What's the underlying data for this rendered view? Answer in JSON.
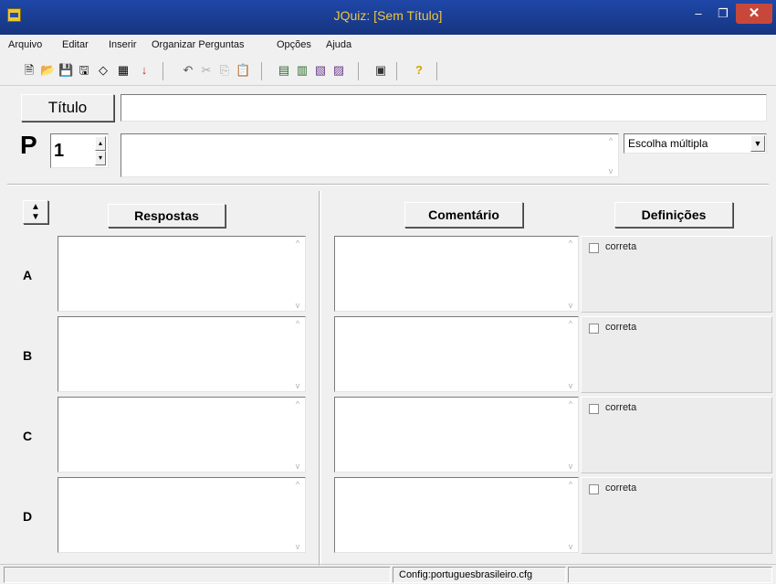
{
  "window": {
    "title": "JQuiz: [Sem Título]",
    "minimize": "–",
    "maximize": "❐",
    "close": "✕"
  },
  "menu": {
    "items": [
      {
        "label": "Arquivo"
      },
      {
        "label": "Editar"
      },
      {
        "label": "Inserir"
      },
      {
        "label": "Organizar Perguntas"
      },
      {
        "label": "Opções"
      },
      {
        "label": "Ajuda"
      }
    ]
  },
  "toolbar": {
    "icons": [
      "new-file-icon",
      "open-folder-icon",
      "save-icon",
      "save-as-icon",
      "eraser-icon",
      "grid-icon",
      "down-arrow-icon",
      "undo-icon",
      "cut-icon",
      "copy-icon",
      "paste-icon",
      "add-question-icon",
      "edit-question-icon",
      "shuffle-icon",
      "find-icon",
      "export-icon",
      "help-icon"
    ],
    "glyphs": [
      "🗎",
      "📂",
      "💾",
      "🖫",
      "◇",
      "▦",
      "↓",
      "↶",
      "✂",
      "⎘",
      "📋",
      "▤",
      "▥",
      "▧",
      "▨",
      "▣",
      "?"
    ],
    "colors": {
      "down_arrow": "#c0302a",
      "help": "#d4a400"
    }
  },
  "title_section": {
    "button_label": "Título",
    "value": ""
  },
  "question": {
    "letter": "P",
    "number": "1",
    "text": "",
    "type_selected": "Escolha múltipla"
  },
  "headers": {
    "respostas": "Respostas",
    "comentario": "Comentário",
    "definicoes": "Definições"
  },
  "answers": [
    {
      "letter": "A",
      "answer": "",
      "comment": "",
      "checkbox_label": "correta"
    },
    {
      "letter": "B",
      "answer": "",
      "comment": "",
      "checkbox_label": "correta"
    },
    {
      "letter": "C",
      "answer": "",
      "comment": "",
      "checkbox_label": "correta"
    },
    {
      "letter": "D",
      "answer": "",
      "comment": "",
      "checkbox_label": "correta"
    }
  ],
  "status": {
    "config": "Config:portuguesbrasileiro.cfg"
  }
}
